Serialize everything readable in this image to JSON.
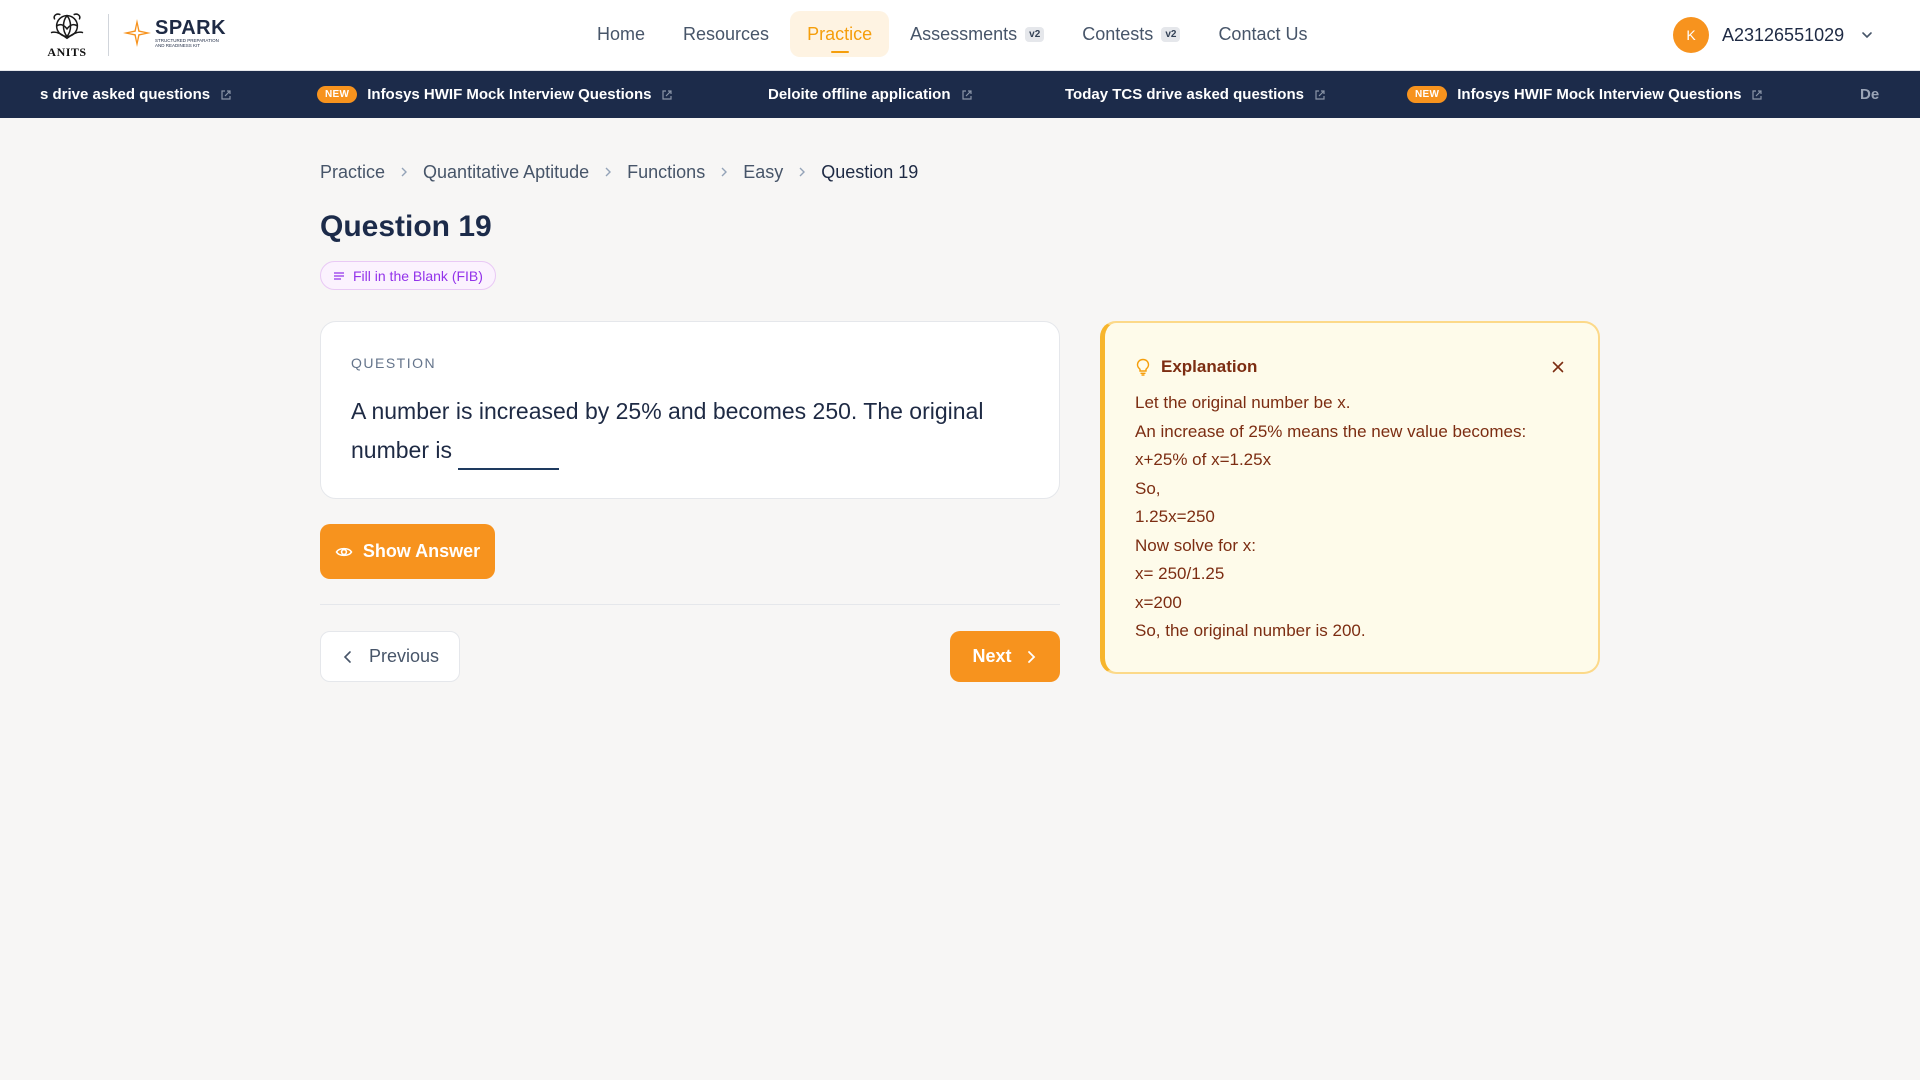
{
  "app": {
    "logo_text": "ANITS",
    "brand_name": "SPARK",
    "brand_tagline": "STRUCTURED PREPARATION AND READINESS KIT",
    "accent_color": "#f7931e",
    "navy_color": "#1c2b4a"
  },
  "nav": {
    "items": [
      {
        "label": "Home"
      },
      {
        "label": "Resources"
      },
      {
        "label": "Practice",
        "active": true
      },
      {
        "label": "Assessments",
        "badge": "v2"
      },
      {
        "label": "Contests",
        "badge": "v2"
      },
      {
        "label": "Contact Us"
      }
    ]
  },
  "user": {
    "avatar_initial": "K",
    "id": "A23126551029"
  },
  "ticker": {
    "items": [
      {
        "text": "s drive asked questions",
        "new": false
      },
      {
        "text": "Infosys HWIF Mock Interview Questions",
        "new": true,
        "badge": "NEW"
      },
      {
        "text": "Deloite offline application",
        "new": false
      },
      {
        "text": "Today TCS drive asked questions",
        "new": false
      },
      {
        "text": "Infosys HWIF Mock Interview Questions",
        "new": true,
        "badge": "NEW"
      },
      {
        "text": "De",
        "new": false
      }
    ]
  },
  "breadcrumb": [
    "Practice",
    "Quantitative Aptitude",
    "Functions",
    "Easy",
    "Question 19"
  ],
  "page": {
    "title": "Question 19",
    "type_label": "Fill in the Blank (FIB)"
  },
  "question": {
    "label": "QUESTION",
    "text": "A number is increased by 25% and becomes 250. The original number is"
  },
  "actions": {
    "show_answer": "Show Answer",
    "previous": "Previous",
    "next": "Next"
  },
  "explanation": {
    "title": "Explanation",
    "lines": [
      "Let the original number be x.",
      "An increase of 25% means the new value becomes:",
      "x+25% of x=1.25x",
      "So,",
      "1.25x=250",
      "Now solve for x:",
      "x= 250/1.25",
      "x=200",
      "So, the original number is 200."
    ]
  }
}
